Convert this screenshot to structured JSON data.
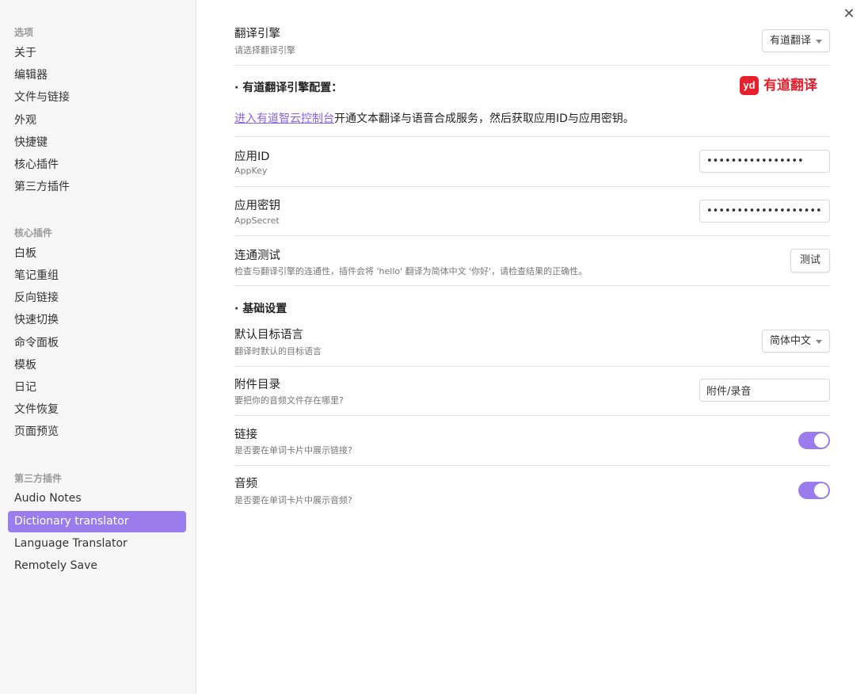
{
  "sidebar": {
    "sections": [
      {
        "title": "选项",
        "items": [
          "关于",
          "编辑器",
          "文件与链接",
          "外观",
          "快捷键",
          "核心插件",
          "第三方插件"
        ]
      },
      {
        "title": "核心插件",
        "items": [
          "白板",
          "笔记重组",
          "反向链接",
          "快速切换",
          "命令面板",
          "模板",
          "日记",
          "文件恢复",
          "页面预览"
        ]
      },
      {
        "title": "第三方插件",
        "items": [
          "Audio Notes",
          "Dictionary translator",
          "Language Translator",
          "Remotely Save"
        ]
      }
    ],
    "active_item": "Dictionary translator"
  },
  "engine": {
    "title": "翻译引擎",
    "desc": "请选择翻译引擎",
    "selected": "有道翻译"
  },
  "youdao_section": {
    "heading": "· 有道翻译引擎配置：",
    "logo_badge": "yd",
    "logo_text": "有道翻译",
    "link_text": "进入有道智云控制台",
    "info_rest": "开通文本翻译与语音合成服务，然后获取应用ID与应用密钥。"
  },
  "app_id": {
    "title": "应用ID",
    "desc": "AppKey",
    "value": "••••••••••••••••"
  },
  "app_secret": {
    "title": "应用密钥",
    "desc": "AppSecret",
    "value": "••••••••••••••••••••••••••••••••"
  },
  "connectivity": {
    "title": "连通测试",
    "desc": "检查与翻译引擎的连通性，插件会将 'hello' 翻译为简体中文 '你好'，请检查结果的正确性。",
    "button": "测试"
  },
  "basic_section": {
    "heading": "· 基础设置"
  },
  "target_lang": {
    "title": "默认目标语言",
    "desc": "翻译时默认的目标语言",
    "selected": "简体中文"
  },
  "attachment": {
    "title": "附件目录",
    "desc": "要把你的音频文件存在哪里?",
    "value": "附件/录音"
  },
  "link_toggle": {
    "title": "链接",
    "desc": "是否要在单词卡片中展示链接?",
    "on": true
  },
  "audio_toggle": {
    "title": "音频",
    "desc": "是否要在单词卡片中展示音频?",
    "on": true
  },
  "close_icon": "close-icon",
  "colors": {
    "accent": "#9b7cec",
    "youdao_red": "#e8202e",
    "link": "#8a63e6"
  }
}
